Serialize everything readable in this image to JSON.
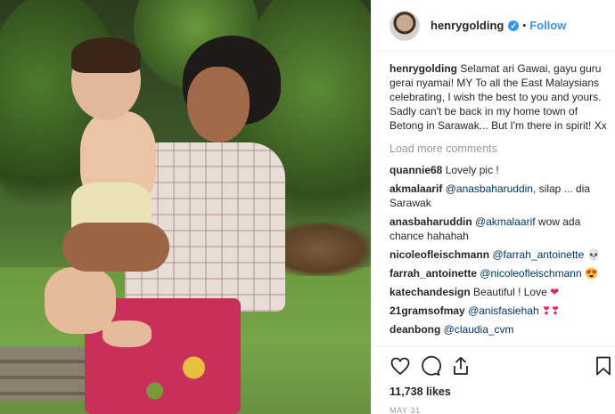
{
  "post": {
    "username": "henrygolding",
    "verified_mark": "✓",
    "dot": "•",
    "follow_label": "Follow"
  },
  "caption": {
    "author": "henrygolding",
    "text": "Selamat ari Gawai, gayu guru gerai nyamai! MY To all the East Malaysians celebrating, I wish the best to you and yours. Sadly can't be back in my home town of Betong in Sarawak... But I'm there in spirit! Xx"
  },
  "load_more_label": "Load more comments",
  "comments": [
    {
      "author": "quannie68",
      "mention": "",
      "text": "Lovely pic !",
      "emoji": ""
    },
    {
      "author": "akmalaarif",
      "mention": "@anasbaharuddin",
      "text": ", silap ... dia Sarawak",
      "emoji": ""
    },
    {
      "author": "anasbaharuddin",
      "mention": "@akmalaarif",
      "text": "wow ada chance hahahah",
      "emoji": ""
    },
    {
      "author": "nicoleofleischmann",
      "mention": "@farrah_antoinette",
      "text": "",
      "emoji": "💀"
    },
    {
      "author": "farrah_antoinette",
      "mention": "@nicoleofleischmann",
      "text": "",
      "emoji": "😍"
    },
    {
      "author": "katechandesign",
      "mention": "",
      "text": "Beautiful ! Love",
      "emoji": "❤"
    },
    {
      "author": "21gramsofmay",
      "mention": "@anisfasiehah",
      "text": "",
      "emoji": "❣❣"
    },
    {
      "author": "deanbong",
      "mention": "@claudia_cvm",
      "text": "",
      "emoji": ""
    }
  ],
  "likes": "11,738 likes",
  "date": "MAY 31",
  "icons": {
    "like": "heart-icon",
    "comment": "comment-bubble-icon",
    "share": "share-icon",
    "save": "bookmark-icon"
  },
  "colors": {
    "link": "#3897f0",
    "mention": "#003569",
    "muted": "#999999",
    "text": "#262626"
  }
}
